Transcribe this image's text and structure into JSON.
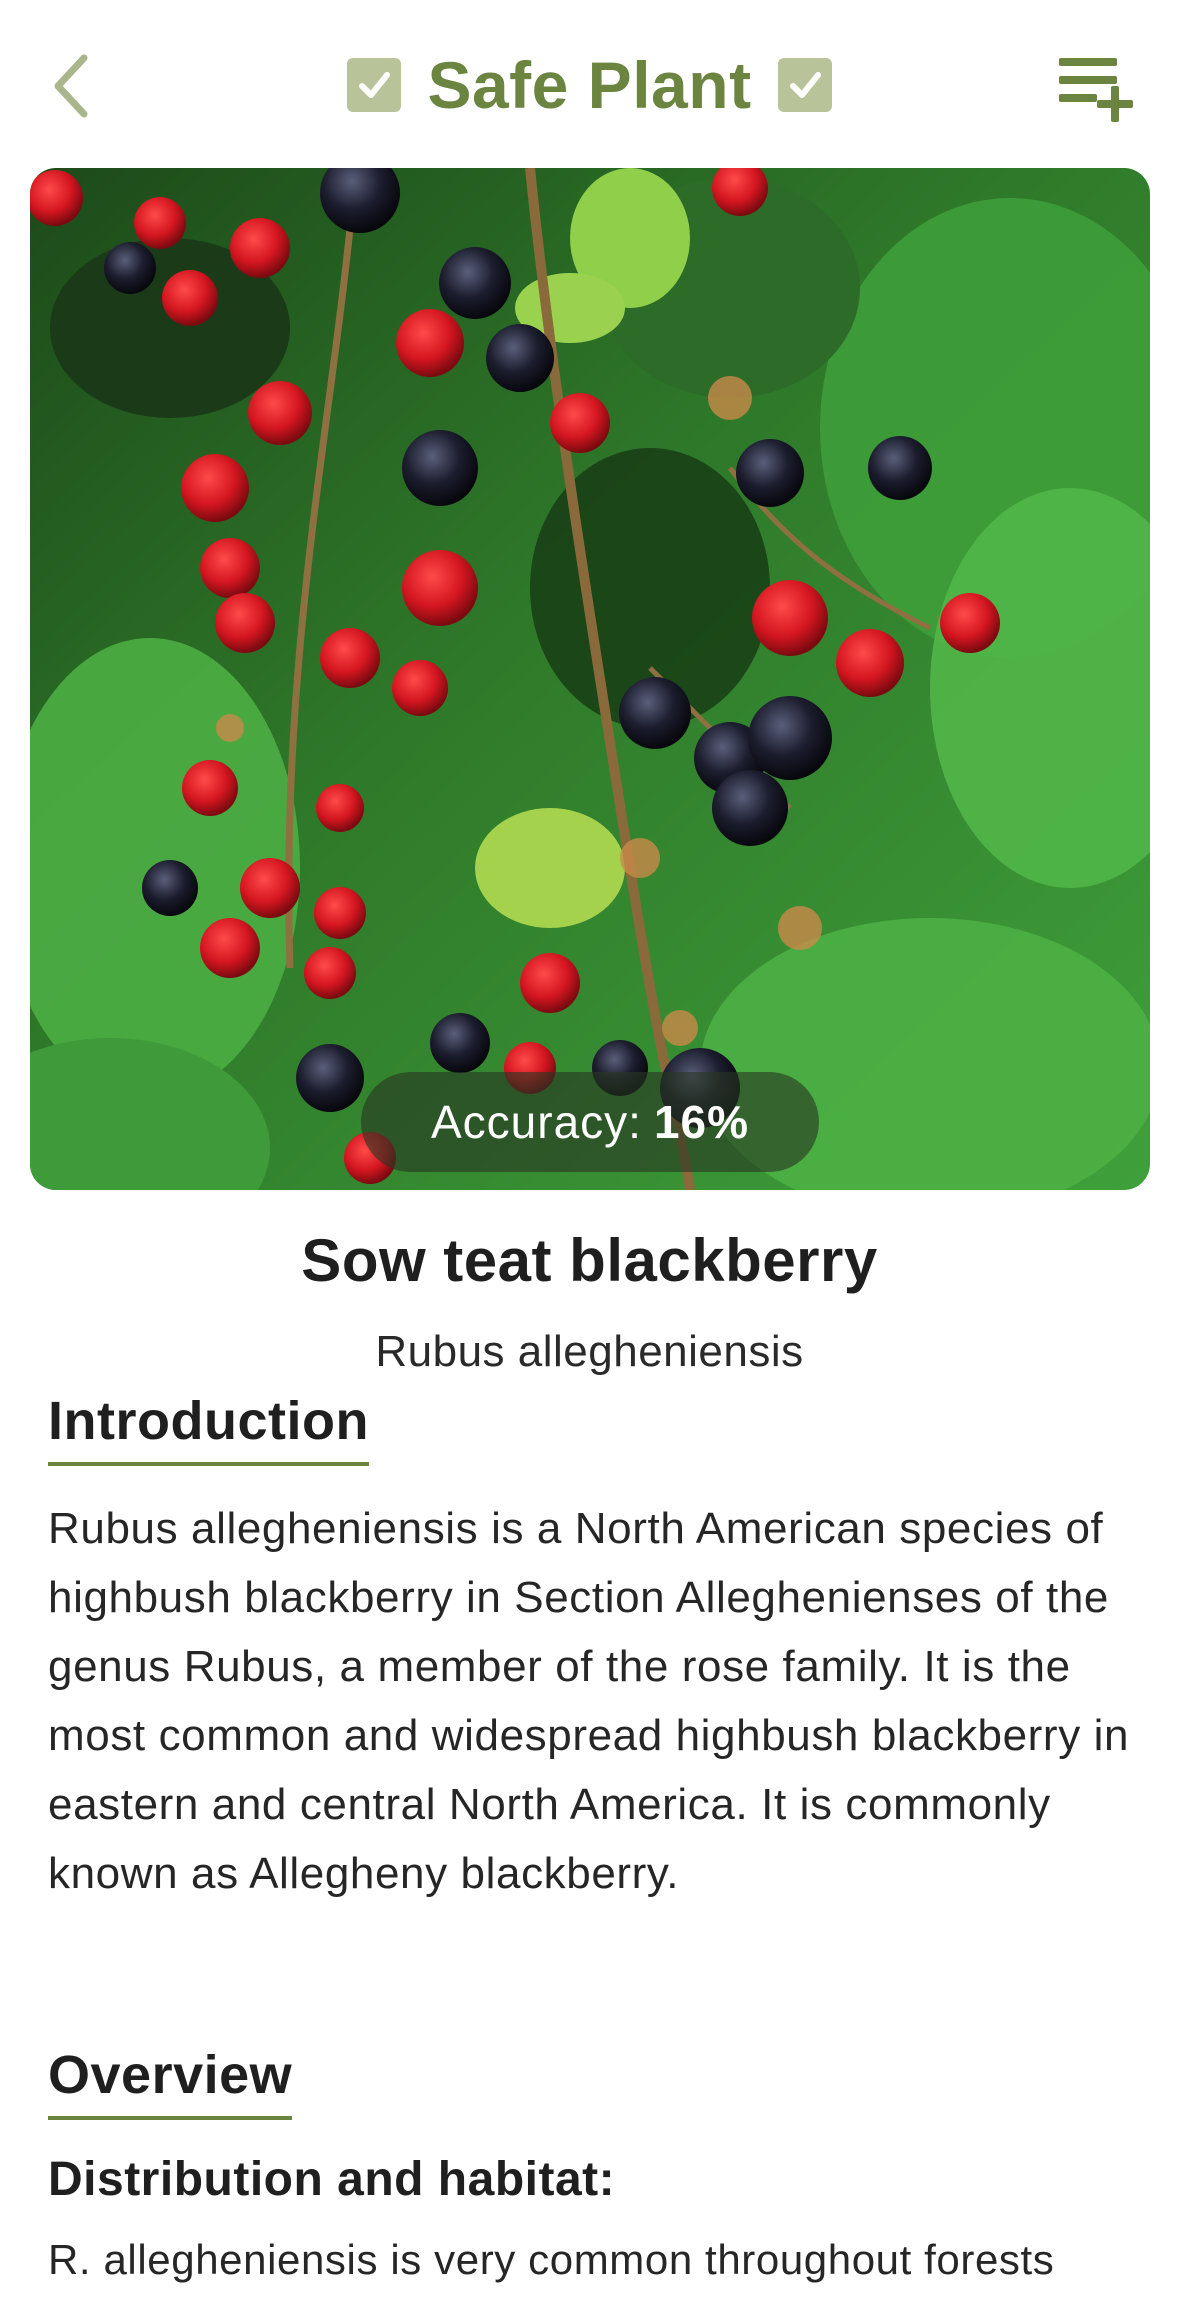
{
  "header": {
    "title": "Safe Plant",
    "back_icon": "chevron-left-icon",
    "add_icon": "playlist-add-icon",
    "check_icon": "checkbox-checked-icon"
  },
  "photo": {
    "subject": "plant-photo",
    "accuracy_label": "Accuracy:",
    "accuracy_value": "16%"
  },
  "plant": {
    "common_name": "Sow teat blackberry",
    "scientific_name": "Rubus allegheniensis"
  },
  "introduction": {
    "heading": "Introduction",
    "text": "Rubus allegheniensis is a North American species of highbush blackberry in Section Alleghenienses of the genus Rubus, a member of the rose family. It is the most common and widespread highbush blackberry in eastern and central North America. It is commonly known as Allegheny blackberry."
  },
  "overview": {
    "heading": "Overview",
    "distribution_heading": "Distribution and habitat:",
    "distribution_text": "R. allegheniensis is very common throughout forests"
  },
  "colors": {
    "accent": "#6b8440",
    "check_fill": "#b9c39a",
    "back_arrow": "#a9b58a",
    "pill_bg": "#2f3f28"
  }
}
